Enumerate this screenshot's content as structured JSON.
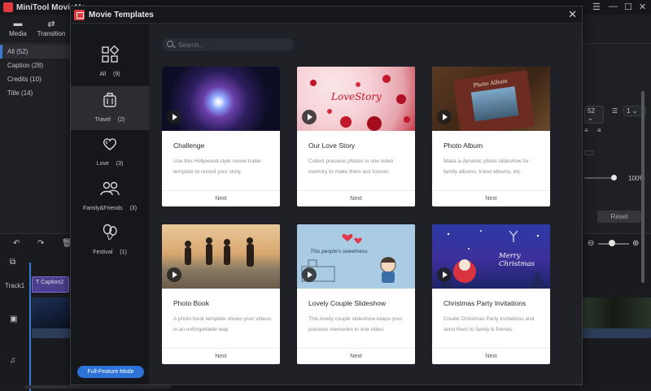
{
  "app": {
    "title": "MiniTool MovieMa",
    "toolbar": [
      {
        "label": "Media",
        "icon": "folder-icon"
      },
      {
        "label": "Transition",
        "icon": "transition-icon"
      }
    ],
    "left_panel": [
      "All (52)",
      "Caption (28)",
      "Credits (10)",
      "Title (14)"
    ],
    "right_panel": {
      "font_size": "52",
      "spacing": "1",
      "percent": "100%",
      "reset_label": "Reset"
    },
    "timeline": {
      "track_label": "Track1",
      "clip_label": "Caption2"
    }
  },
  "modal": {
    "title": "Movie Templates",
    "search_placeholder": "Search...",
    "categories": [
      {
        "label": "All",
        "count": "(9)",
        "icon": "grid-icon"
      },
      {
        "label": "Travel",
        "count": "(2)",
        "icon": "suitcase-icon"
      },
      {
        "label": "Love",
        "count": "(3)",
        "icon": "hearts-icon"
      },
      {
        "label": "Family&Friends",
        "count": "(3)",
        "icon": "people-icon"
      },
      {
        "label": "Festival",
        "count": "(1)",
        "icon": "balloons-icon"
      }
    ],
    "full_feature_label": "Full-Feature Mode",
    "cards": [
      {
        "title": "Challenge",
        "desc": "Use this Hollywood-style movie trailer template to record your story.",
        "next": "Next",
        "thumb_text": ""
      },
      {
        "title": "Our Love Story",
        "desc": "Collect precious photos in one video memory to make them last forever.",
        "next": "Next",
        "thumb_text": "LoveStory"
      },
      {
        "title": "Photo Album",
        "desc": "Make a dynamic photo slideshow for family albums, travel albums, etc.",
        "next": "Next",
        "thumb_text": "Photo Album"
      },
      {
        "title": "Photo Book",
        "desc": "A photo book template shows your videos in an unforgettable way.",
        "next": "Next",
        "thumb_text": ""
      },
      {
        "title": "Lovely Couple Slideshow",
        "desc": "This lovely couple slideshow keeps your precious memories in one video.",
        "next": "Next",
        "thumb_text": "This people's sweetness"
      },
      {
        "title": "Christmas Party Invitations",
        "desc": "Create Christmas Party Invitations and send them to family & friends.",
        "next": "Next",
        "thumb_text": "Merry Christmas"
      }
    ]
  },
  "colors": {
    "accent": "#2e73d8",
    "brand": "#e0393e"
  }
}
